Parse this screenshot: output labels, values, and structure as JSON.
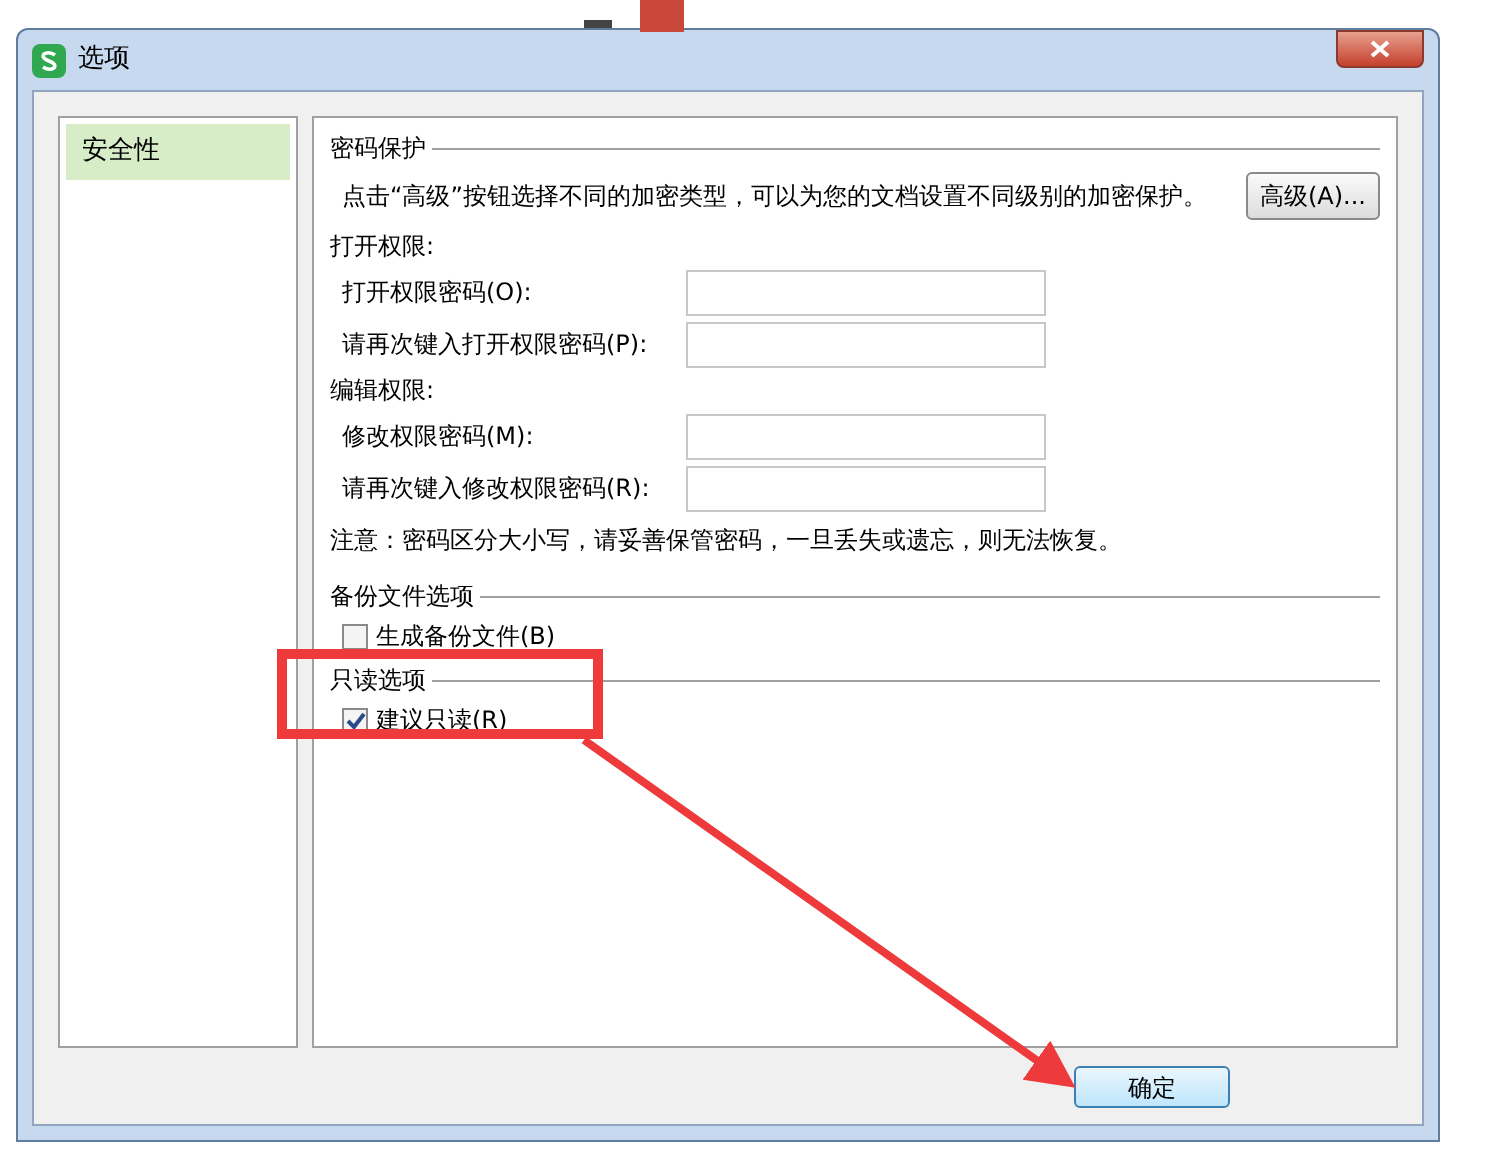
{
  "window": {
    "title": "选项"
  },
  "sidebar": {
    "items": [
      {
        "label": "安全性",
        "selected": true
      }
    ]
  },
  "password_protection": {
    "title": "密码保护",
    "description": "点击“高级”按钮选择不同的加密类型，可以为您的文档设置不同级别的加密保护。",
    "advanced_button": "高级(A)..."
  },
  "permission_groups": [
    {
      "title": "打开权限:",
      "fields": [
        {
          "label": "打开权限密码(O):"
        },
        {
          "label": "请再次键入打开权限密码(P):"
        }
      ]
    },
    {
      "title": "编辑权限:",
      "fields": [
        {
          "label": "修改权限密码(M):"
        },
        {
          "label": "请再次键入修改权限密码(R):"
        }
      ]
    }
  ],
  "note": "注意：密码区分大小写，请妥善保管密码，一旦丢失或遗忘，则无法恢复。",
  "option_groups": [
    {
      "title": "备份文件选项",
      "checkboxes": [
        {
          "label": "生成备份文件(B)",
          "checked": false
        }
      ]
    },
    {
      "title": "只读选项",
      "checkboxes": [
        {
          "label": "建议只读(R)",
          "checked": true
        }
      ]
    }
  ],
  "buttons": [
    {
      "label": "确定"
    }
  ]
}
